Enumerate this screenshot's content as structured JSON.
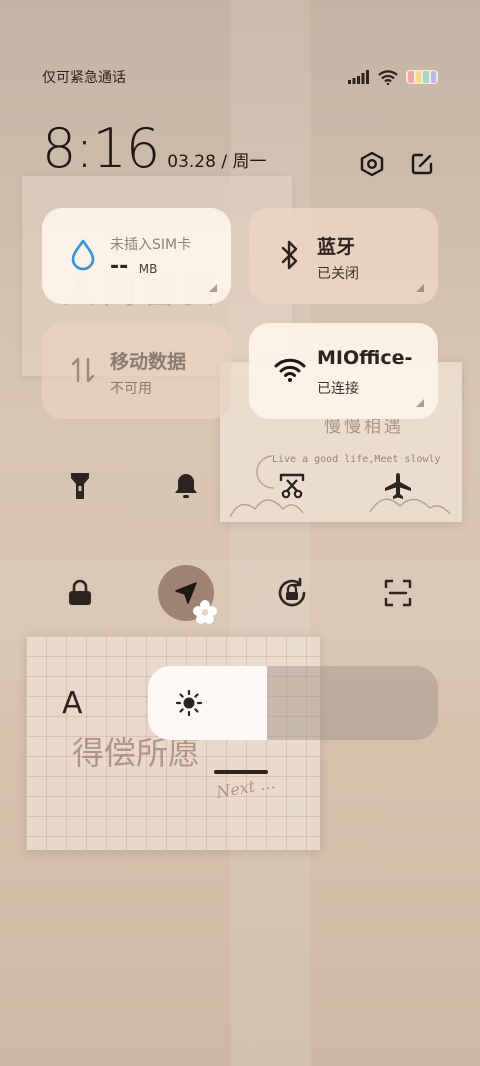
{
  "status_bar": {
    "carrier": "仅可紧急通话",
    "signal_icon": "signal-bars-icon",
    "wifi_icon": "wifi-icon",
    "battery_colors": [
      "#f4a7a0",
      "#f7d88a",
      "#9fd8c4",
      "#b8b8f0"
    ]
  },
  "clock": {
    "time": "8:16",
    "date": "03.28 / 周一"
  },
  "header_actions": [
    {
      "name": "settings-icon"
    },
    {
      "name": "edit-icon"
    }
  ],
  "tiles": {
    "data_usage": {
      "label": "未插入SIM卡",
      "value": "--",
      "unit": "MB",
      "icon": "water-drop-icon"
    },
    "bluetooth": {
      "label": "蓝牙",
      "status": "已关闭",
      "icon": "bluetooth-icon"
    },
    "mobile_data": {
      "label": "移动数据",
      "status": "不可用",
      "icon": "data-arrows-icon"
    },
    "wifi": {
      "label": "MIOffice-",
      "status": "已连接",
      "icon": "wifi-icon"
    }
  },
  "toggles_row1": [
    {
      "name": "flashlight-icon"
    },
    {
      "name": "bell-icon"
    },
    {
      "name": "screenshot-scissors-icon"
    },
    {
      "name": "airplane-icon"
    }
  ],
  "toggles_row2": [
    {
      "name": "lock-icon"
    },
    {
      "name": "location-icon",
      "active": true
    },
    {
      "name": "rotation-lock-icon"
    },
    {
      "name": "scan-icon"
    }
  ],
  "brightness": {
    "level": 0.41,
    "icon": "sun-icon"
  },
  "font_button": {
    "label": "A"
  },
  "decor": {
    "photo1_text": "人间皆安",
    "photo2_title": "慢慢相遇",
    "photo2_caption": "Live a good life,Meet slowly",
    "photo3_text": "得偿所愿",
    "photo3_sub": "Next ..."
  },
  "colors": {
    "active_location_bg": "#a08272",
    "bluetooth_accent": "#2b2420",
    "drop_accent": "#2e95e6"
  }
}
